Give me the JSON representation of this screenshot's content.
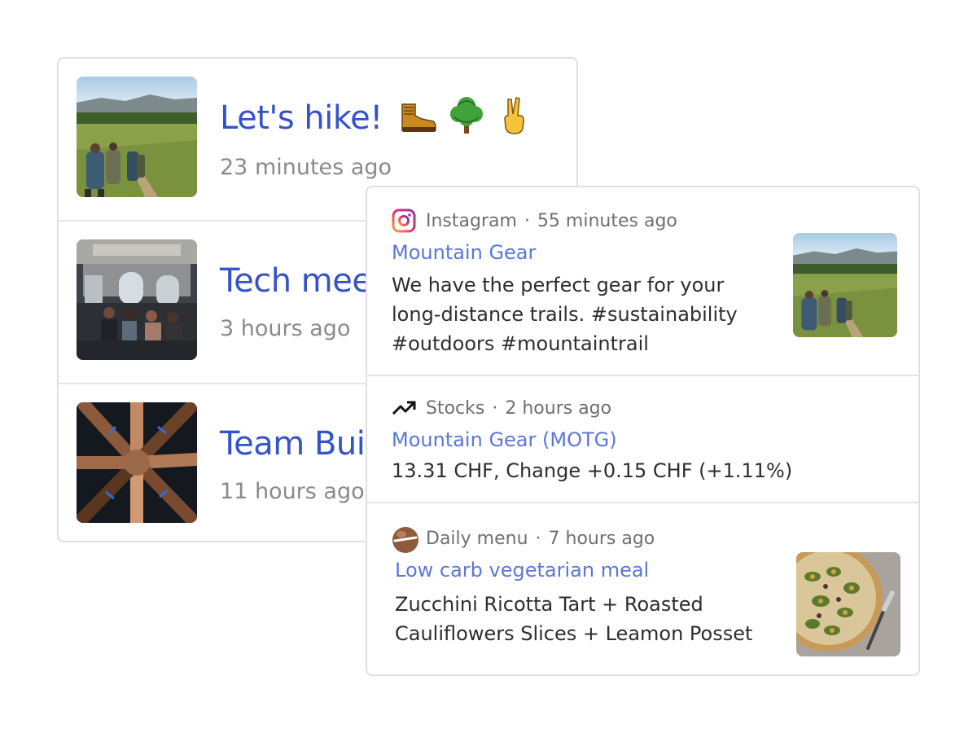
{
  "events": [
    {
      "title": "Let's hike!",
      "emojis": [
        "hiking-boot",
        "tree",
        "victory-hand"
      ],
      "time": "23 minutes ago",
      "image": "hikers-photo"
    },
    {
      "title": "Tech mee",
      "time": "3 hours ago",
      "image": "meeting-room-photo"
    },
    {
      "title": "Team Bui",
      "time": "11 hours ago",
      "image": "team-hands-photo"
    }
  ],
  "feed": [
    {
      "source": "Instagram",
      "separator": "·",
      "time": "55 minutes ago",
      "icon": "instagram-icon",
      "title": "Mountain Gear",
      "body": "We have the perfect gear for your long-distance trails. #sustainability #outdoors #mountaintrail",
      "image": "hikers-photo"
    },
    {
      "source": "Stocks",
      "separator": "·",
      "time": "2 hours ago",
      "icon": "trending-up-icon",
      "title": "Mountain Gear (MOTG)",
      "body": "13.31 CHF, Change +0.15 CHF (+1.11%)"
    },
    {
      "source": "Daily menu",
      "separator": "·",
      "time": "7 hours ago",
      "icon": "daily-menu-icon",
      "title": "Low carb vegetarian meal",
      "body": "Zucchini Ricotta Tart + Roasted Cauliflowers Slices + Leamon Posset",
      "image": "tart-photo"
    }
  ],
  "colors": {
    "link": "#5b77d8",
    "title": "#3553c9",
    "muted": "#8a8a8a",
    "border": "#e0e0e0"
  }
}
